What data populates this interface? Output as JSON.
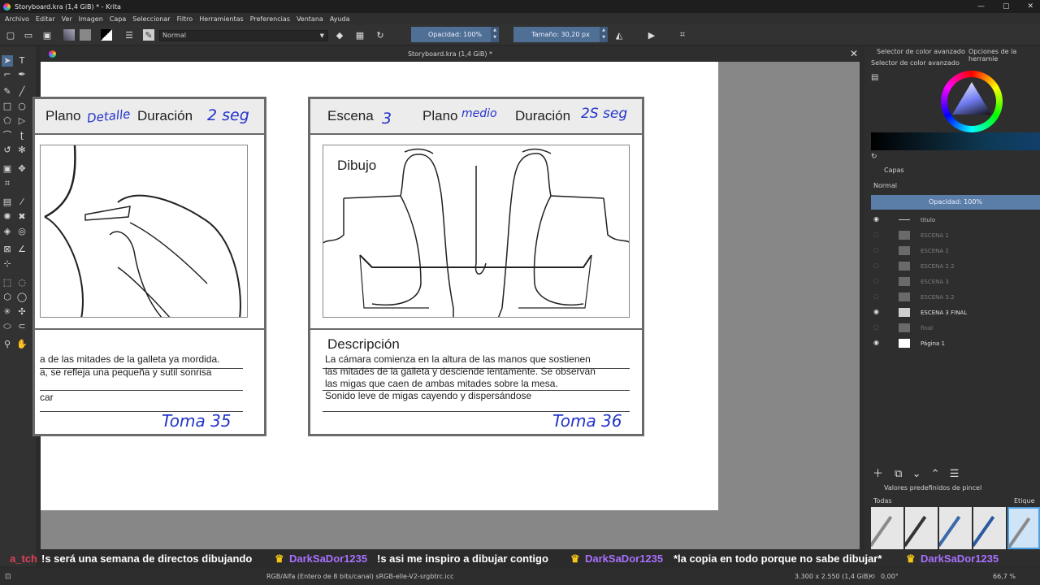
{
  "window": {
    "title": "Storyboard.kra (1,4 GiB) * - Krita",
    "buttons": [
      "—",
      "▢",
      "✕"
    ]
  },
  "menu": [
    "Archivo",
    "Editar",
    "Ver",
    "Imagen",
    "Capa",
    "Seleccionar",
    "Filtro",
    "Herramientas",
    "Preferencias",
    "Ventana",
    "Ayuda"
  ],
  "toolbar": {
    "blend_mode": "Normal",
    "opacity": "Opacidad: 100%",
    "size": "Tamaño: 30,20 px"
  },
  "document": {
    "tab_title": "Storyboard.kra (1,4 GiB) *"
  },
  "storyboard": {
    "panel1": {
      "plano_label": "Plano",
      "plano_value": "Detalle",
      "duracion_label": "Duración",
      "duracion_value": "2 seg",
      "lines": [
        "a de las mitades de la galleta ya mordida.",
        "a, se refleja una pequeña y sutil sonrisa",
        "car"
      ],
      "toma": "Toma 35"
    },
    "panel2": {
      "escena_label": "Escena",
      "escena_value": "3",
      "plano_label": "Plano",
      "plano_value": "medio",
      "duracion_label": "Duración",
      "duracion_value": "2S seg",
      "dibujo_label": "Dibujo",
      "descripcion_label": "Descripción",
      "lines": [
        "La cámara comienza en la altura de las manos que sostienen",
        "las mitades de la galleta y desciende lentamente. Se observan",
        " las migas que caen de ambas mitades sobre la mesa.",
        "Sonido leve de migas cayendo y dispersándose"
      ],
      "toma": "Toma 36"
    }
  },
  "right_panel": {
    "tab1": "Selector de color avanzado",
    "tab2": "Opciones de la herramie",
    "color_header": "Selector de color avanzado",
    "layers_header": "Capas",
    "layer_blend": "Normal",
    "layer_opacity": "Opacidad:  100%",
    "layers": [
      {
        "name": "titulo",
        "visible": true
      },
      {
        "name": "ESCENA 1",
        "visible": false
      },
      {
        "name": "ESCENA 2",
        "visible": false
      },
      {
        "name": "ESCENA 2.2",
        "visible": false
      },
      {
        "name": "ESCENA 3",
        "visible": false
      },
      {
        "name": "ESCENA 3.2",
        "visible": false
      },
      {
        "name": "ESCENA 3 FINAL",
        "visible": true
      },
      {
        "name": "final",
        "visible": false
      },
      {
        "name": "Página 1",
        "visible": true
      }
    ],
    "presets_header": "Valores predefinidos de pincel",
    "presets_filter": "Todas",
    "presets_tag": "Etique"
  },
  "chat": [
    {
      "user": "a_tch",
      "message": "!s será una semana de directos dibujando"
    },
    {
      "user": "DarkSaDor1235",
      "message": "!s asi me inspiro a dibujar contigo"
    },
    {
      "user": "DarkSaDor1235",
      "message": "*la copia en todo porque no sabe dibujar*"
    },
    {
      "user": "DarkSaDor1235",
      "message": ""
    }
  ],
  "status": {
    "color_space": "RGB/Alfa (Entero de 8 bits/canal)  sRGB-elle-V2-srgbtrc.icc",
    "dimensions": "3.300 x 2.550 (1,4 GiB)",
    "rotation": "0,00°",
    "zoom": "66,7 %"
  },
  "colors": {
    "accent": "#4f6f95",
    "ink_blue": "#2233cc"
  }
}
